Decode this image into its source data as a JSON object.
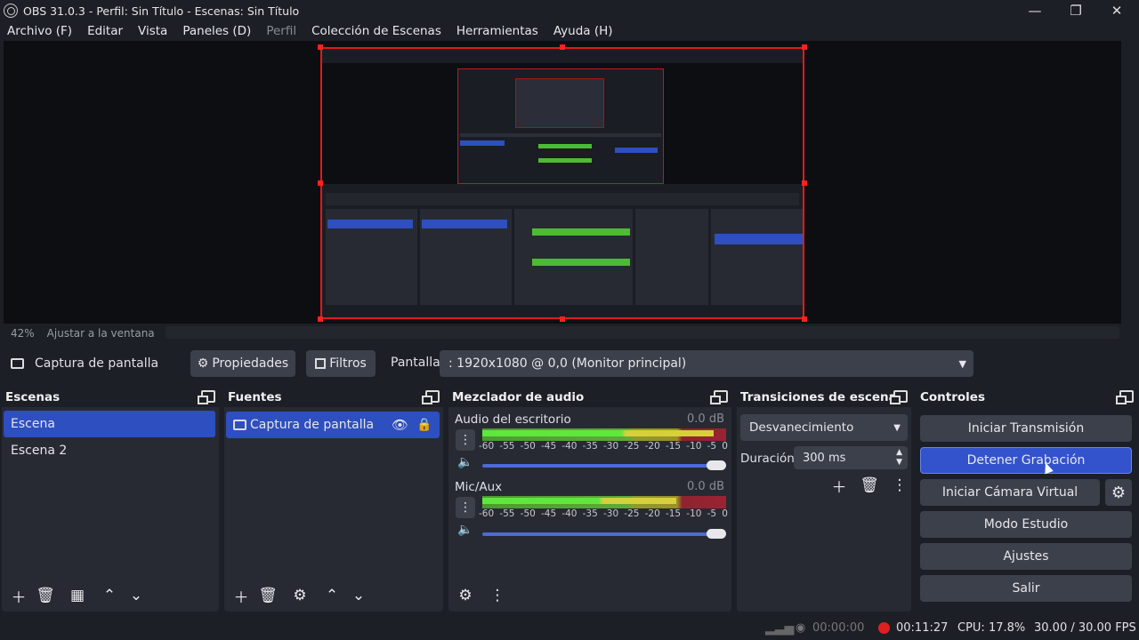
{
  "window": {
    "title": "OBS 31.0.3 - Perfil: Sin Título - Escenas: Sin Título"
  },
  "menu": [
    {
      "label": "Archivo (F)",
      "dim": false
    },
    {
      "label": "Editar",
      "dim": false
    },
    {
      "label": "Vista",
      "dim": false
    },
    {
      "label": "Paneles (D)",
      "dim": false
    },
    {
      "label": "Perfil",
      "dim": true
    },
    {
      "label": "Colección de Escenas",
      "dim": false
    },
    {
      "label": "Herramientas",
      "dim": false
    },
    {
      "label": "Ayuda (H)",
      "dim": false
    }
  ],
  "preview": {
    "zoom": "42%",
    "fit_label": "Ajustar a la ventana"
  },
  "source_bar": {
    "source_name": "Captura de pantalla",
    "properties": "Propiedades",
    "filters": "Filtros",
    "display_label": "Pantalla",
    "display_value": ": 1920x1080 @ 0,0 (Monitor principal)"
  },
  "scenes": {
    "title": "Escenas",
    "items": [
      "Escena",
      "Escena 2"
    ],
    "selected": 0
  },
  "sources": {
    "title": "Fuentes",
    "items": [
      "Captura de pantalla"
    ]
  },
  "mixer": {
    "title": "Mezclador de audio",
    "channels": [
      {
        "name": "Audio del escritorio",
        "db": "0.0 dB",
        "level": 0.95,
        "volume": 1.0
      },
      {
        "name": "Mic/Aux",
        "db": "0.0 dB",
        "level": 0.8,
        "volume": 1.0
      }
    ],
    "scale": [
      "-60",
      "-55",
      "-50",
      "-45",
      "-40",
      "-35",
      "-30",
      "-25",
      "-20",
      "-15",
      "-10",
      "-5",
      "0"
    ]
  },
  "transitions": {
    "title": "Transiciones de escena",
    "type": "Desvanecimiento",
    "duration_label": "Duración",
    "duration": "300 ms"
  },
  "controls": {
    "title": "Controles",
    "start_stream": "Iniciar Transmisión",
    "stop_record": "Detener Grabación",
    "virtual_cam": "Iniciar Cámara Virtual",
    "studio_mode": "Modo Estudio",
    "settings": "Ajustes",
    "exit": "Salir"
  },
  "status": {
    "stream_time": "00:00:00",
    "rec_time": "00:11:27",
    "cpu": "CPU: 17.8%",
    "fps": "30.00 / 30.00 FPS"
  },
  "colors": {
    "accent": "#3353cc",
    "record": "#e02020",
    "meter_green": "#5ee83c"
  }
}
